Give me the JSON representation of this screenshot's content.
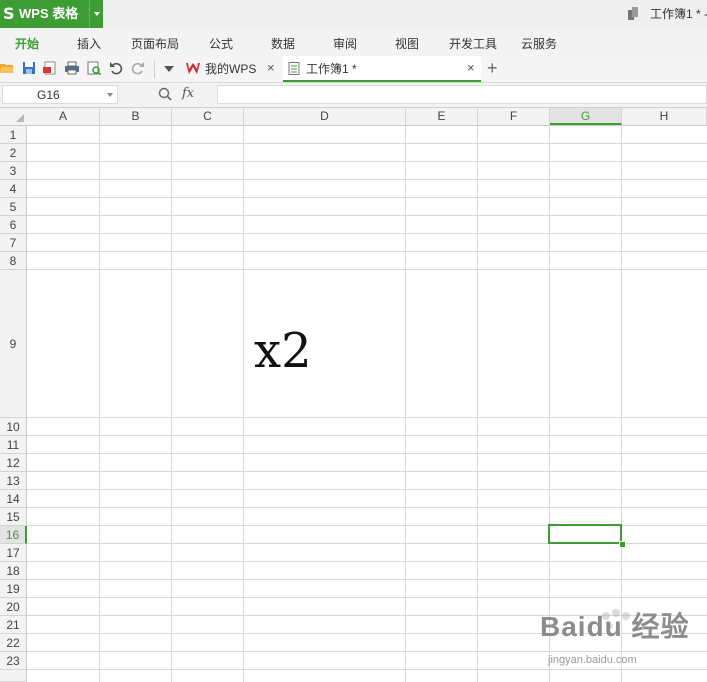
{
  "app": {
    "logo_glyph": "S",
    "name": "WPS 表格"
  },
  "window": {
    "title": "工作簿1 * -"
  },
  "menu": [
    {
      "label": "开始",
      "active": true
    },
    {
      "label": "插入"
    },
    {
      "label": "页面布局"
    },
    {
      "label": "公式"
    },
    {
      "label": "数据"
    },
    {
      "label": "审阅"
    },
    {
      "label": "视图"
    },
    {
      "label": "开发工具"
    },
    {
      "label": "云服务"
    }
  ],
  "toolbar": {
    "icons": [
      "open-folder-icon",
      "save-icon",
      "export-pdf-icon",
      "print-icon",
      "print-preview-icon",
      "undo-icon",
      "redo-icon",
      "dropdown-arrow-icon"
    ]
  },
  "tabs": [
    {
      "label": "我的WPS",
      "icon": "wps-logo-icon",
      "close": "×"
    },
    {
      "label": "工作簿1 *",
      "icon": "spreadsheet-doc-icon",
      "close": "×",
      "active": true
    }
  ],
  "new_tab_label": "+",
  "formula_bar": {
    "name_box": "G16",
    "fx_label": "fx",
    "formula": ""
  },
  "columns": [
    "A",
    "B",
    "C",
    "D",
    "E",
    "F",
    "G",
    "H"
  ],
  "selected_column": "G",
  "rows": [
    "1",
    "2",
    "3",
    "4",
    "5",
    "6",
    "7",
    "8",
    "9",
    "10",
    "11",
    "12",
    "13",
    "14",
    "15",
    "16",
    "17",
    "18",
    "19",
    "20",
    "21",
    "22",
    "23"
  ],
  "selected_row": "16",
  "cells": {
    "D9": "x2"
  },
  "colors": {
    "accent": "#3e9c35",
    "grid": "#d8d8d8"
  },
  "watermark": {
    "text": "Baidu 经验",
    "url": "jingyan.baidu.com"
  }
}
